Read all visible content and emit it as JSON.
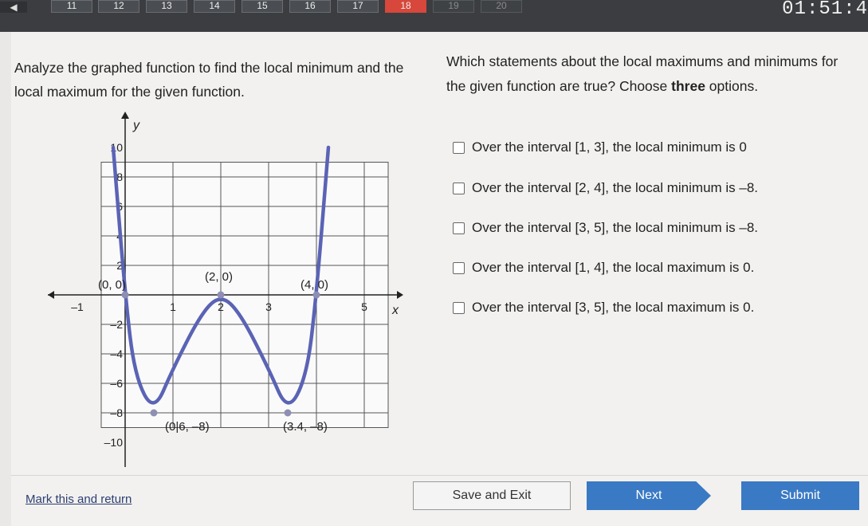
{
  "header": {
    "prev_glyph": "◀",
    "questions": [
      "11",
      "12",
      "13",
      "14",
      "15",
      "16",
      "17",
      "18",
      "19",
      "20"
    ],
    "current_question": "18",
    "timer": "01:51:4"
  },
  "question": {
    "left_prompt": "Analyze the graphed function to find the local minimum and the local maximum for the given function.",
    "right_prompt_main": "Which statements about the local maximums and minimums for the given function are true? Choose ",
    "right_prompt_bold": "three",
    "right_prompt_end": " options.",
    "options": [
      "Over the interval [1, 3], the local minimum is 0",
      "Over the interval [2, 4], the local minimum is –8.",
      "Over the interval [3, 5], the local minimum is –8.",
      "Over the interval [1, 4], the local maximum is 0.",
      "Over the interval [3, 5], the local maximum is 0."
    ]
  },
  "chart_data": {
    "type": "line",
    "xlabel": "x",
    "ylabel": "y",
    "xlim": [
      -1,
      6
    ],
    "ylim": [
      -10,
      10
    ],
    "x_ticks": [
      "–1",
      "1",
      "2",
      "3",
      "5"
    ],
    "y_ticks": [
      "10",
      "8",
      "6",
      "4",
      "2",
      "–2",
      "–4",
      "–6",
      "–8",
      "–10"
    ],
    "series": [
      {
        "points": [
          [
            -0.25,
            10
          ],
          [
            0,
            0
          ],
          [
            0.2,
            -5.5
          ],
          [
            0.6,
            -8
          ],
          [
            1.0,
            -5
          ],
          [
            1.6,
            -1.2
          ],
          [
            2,
            0
          ],
          [
            2.4,
            -1.2
          ],
          [
            3.0,
            -5
          ],
          [
            3.4,
            -8
          ],
          [
            3.8,
            -5.5
          ],
          [
            4,
            0
          ],
          [
            4.25,
            10
          ]
        ],
        "color": "#5b63b5"
      }
    ],
    "point_labels": [
      "(0, 0)",
      "(2, 0)",
      "(4, 0)",
      "(0.6, –8)",
      "(3.4, –8)"
    ],
    "point_label_display": [
      "(0, 0)",
      "(2, 0)",
      "(4, 0)",
      "(0|6, –8)",
      "(3.4, –8)"
    ]
  },
  "footer": {
    "mark_label": "Mark this and return",
    "save_label": "Save and Exit",
    "next_label": "Next",
    "submit_label": "Submit"
  }
}
